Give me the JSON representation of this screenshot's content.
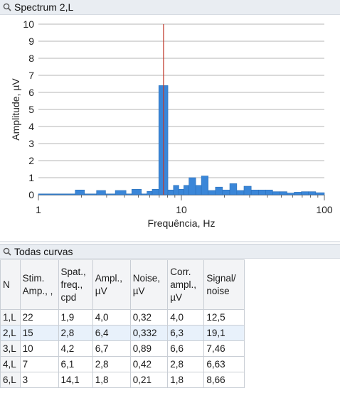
{
  "spectrum_panel": {
    "title": "Spectrum 2,L"
  },
  "table_panel": {
    "title": "Todas curvas"
  },
  "chart_data": {
    "type": "bar",
    "title": "",
    "xlabel": "Frequência, Hz",
    "ylabel": "Amplitude, µV",
    "xscale": "log",
    "xlim": [
      1,
      100
    ],
    "ylim": [
      0,
      10
    ],
    "yticks": [
      "0",
      "1",
      "2",
      "3",
      "4",
      "5",
      "6",
      "7",
      "8",
      "9",
      "10"
    ],
    "xticks": [
      "1",
      "10",
      "100"
    ],
    "grid": "horizontal",
    "bar_color": "#3a86d8",
    "marker_color": "#c0392b",
    "marker_x": 7.5,
    "marker_y": 10,
    "bins": [
      {
        "x0": 1.0,
        "x1": 1.81,
        "y": 0.05
      },
      {
        "x0": 1.81,
        "x1": 2.1,
        "y": 0.28
      },
      {
        "x0": 2.1,
        "x1": 2.55,
        "y": 0.05
      },
      {
        "x0": 2.55,
        "x1": 2.95,
        "y": 0.25
      },
      {
        "x0": 2.95,
        "x1": 3.45,
        "y": 0.05
      },
      {
        "x0": 3.45,
        "x1": 4.1,
        "y": 0.25
      },
      {
        "x0": 4.1,
        "x1": 4.5,
        "y": 0.05
      },
      {
        "x0": 4.5,
        "x1": 5.25,
        "y": 0.32
      },
      {
        "x0": 5.25,
        "x1": 5.75,
        "y": 0.05
      },
      {
        "x0": 5.75,
        "x1": 6.25,
        "y": 0.2
      },
      {
        "x0": 6.25,
        "x1": 6.95,
        "y": 0.32
      },
      {
        "x0": 6.95,
        "x1": 8.05,
        "y": 6.4
      },
      {
        "x0": 8.05,
        "x1": 8.8,
        "y": 0.28
      },
      {
        "x0": 8.8,
        "x1": 9.6,
        "y": 0.55
      },
      {
        "x0": 9.6,
        "x1": 10.4,
        "y": 0.32
      },
      {
        "x0": 10.4,
        "x1": 11.3,
        "y": 0.55
      },
      {
        "x0": 11.3,
        "x1": 12.6,
        "y": 1.0
      },
      {
        "x0": 12.6,
        "x1": 13.8,
        "y": 0.55
      },
      {
        "x0": 13.8,
        "x1": 15.4,
        "y": 1.1
      },
      {
        "x0": 15.4,
        "x1": 17.3,
        "y": 0.25
      },
      {
        "x0": 17.3,
        "x1": 19.4,
        "y": 0.45
      },
      {
        "x0": 19.4,
        "x1": 21.8,
        "y": 0.28
      },
      {
        "x0": 21.8,
        "x1": 24.4,
        "y": 0.65
      },
      {
        "x0": 24.4,
        "x1": 27.4,
        "y": 0.25
      },
      {
        "x0": 27.4,
        "x1": 30.8,
        "y": 0.5
      },
      {
        "x0": 30.8,
        "x1": 34.6,
        "y": 0.28
      },
      {
        "x0": 34.6,
        "x1": 38.8,
        "y": 0.28
      },
      {
        "x0": 38.8,
        "x1": 43.5,
        "y": 0.28
      },
      {
        "x0": 43.5,
        "x1": 48.8,
        "y": 0.18
      },
      {
        "x0": 48.8,
        "x1": 54.8,
        "y": 0.18
      },
      {
        "x0": 54.8,
        "x1": 61.5,
        "y": 0.1
      },
      {
        "x0": 61.5,
        "x1": 69.0,
        "y": 0.15
      },
      {
        "x0": 69.0,
        "x1": 77.5,
        "y": 0.18
      },
      {
        "x0": 77.5,
        "x1": 87.0,
        "y": 0.18
      },
      {
        "x0": 87.0,
        "x1": 100.0,
        "y": 0.12
      }
    ]
  },
  "table": {
    "headers": [
      [
        "N"
      ],
      [
        "Stim.",
        "Amp., ,"
      ],
      [
        "Spat.,",
        "freq.,",
        "cpd"
      ],
      [
        "Ampl.,",
        "µV"
      ],
      [
        "Noise,",
        "µV"
      ],
      [
        "Corr.",
        "ampl.,",
        "µV"
      ],
      [
        "Signal/",
        "noise"
      ]
    ],
    "rows": [
      [
        "1,L",
        "22",
        "1,9",
        "4,0",
        "0,32",
        "4,0",
        "12,5"
      ],
      [
        "2,L",
        "15",
        "2,8",
        "6,4",
        "0,332",
        "6,3",
        "19,1"
      ],
      [
        "3,L",
        "10",
        "4,2",
        "6,7",
        "0,89",
        "6,6",
        "7,46"
      ],
      [
        "4,L",
        "7",
        "6,1",
        "2,8",
        "0,42",
        "2,8",
        "6,63"
      ],
      [
        "6,L",
        "3",
        "14,1",
        "1,8",
        "0,21",
        "1,8",
        "8,66"
      ]
    ],
    "selected_row": 1
  }
}
